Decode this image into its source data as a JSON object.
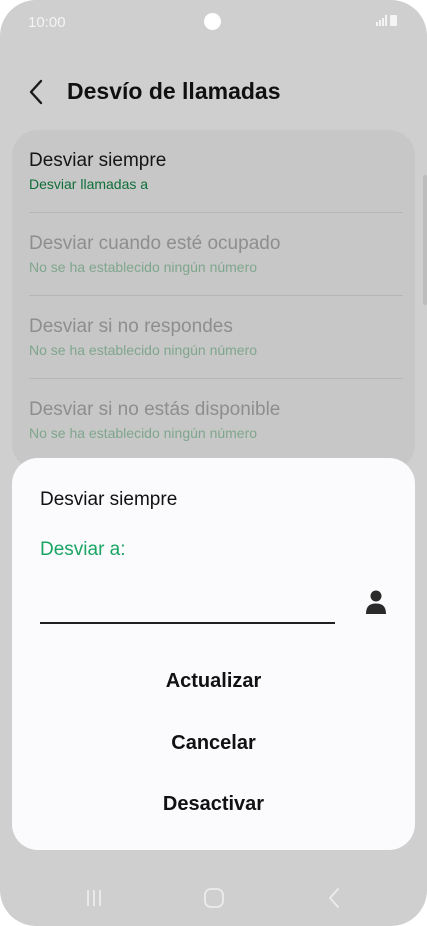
{
  "status_bar": {
    "time": "10:00",
    "icons": [
      "camera-cutout-icon",
      "signal-icon",
      "battery-icon"
    ]
  },
  "header": {
    "back_icon": "chevron-left-icon",
    "title": "Desvío de llamadas"
  },
  "forwarding_options": [
    {
      "title": "Desviar siempre",
      "subtitle": "Desviar llamadas a",
      "enabled": true
    },
    {
      "title": "Desviar cuando esté ocupado",
      "subtitle": "No se ha establecido ningún número",
      "enabled": false
    },
    {
      "title": "Desviar si no respondes",
      "subtitle": "No se ha establecido ningún número",
      "enabled": false
    },
    {
      "title": "Desviar si no estás disponible",
      "subtitle": "No se ha establecido ningún número",
      "enabled": false
    }
  ],
  "dialog": {
    "title": "Desviar siempre",
    "field_label": "Desviar a:",
    "field_value": "",
    "contact_icon": "person-icon",
    "buttons": {
      "update": "Actualizar",
      "cancel": "Cancelar",
      "deactivate": "Desactivar"
    }
  },
  "nav_bar": {
    "icons": [
      "recent-apps-icon",
      "home-icon",
      "back-icon"
    ]
  },
  "colors": {
    "accent_green": "#1aa563",
    "active_subtitle": "#0f6e3a",
    "scrim_background": "#cfcfcf",
    "dialog_background": "#fbfbfe"
  }
}
